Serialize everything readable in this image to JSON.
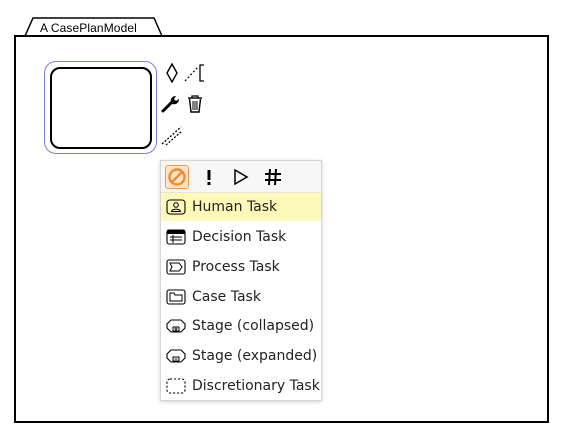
{
  "case_plan_model": {
    "name": "A CasePlanModel"
  },
  "selected_task": {
    "label": ""
  },
  "context_pad": {
    "icons": [
      "diamond-icon",
      "connector-bracket-icon",
      "wrench-icon",
      "trash-icon",
      "dashed-connector-icon"
    ]
  },
  "popup_menu": {
    "header_buttons": [
      {
        "name": "blocking-toggle",
        "symbol": "⊘",
        "active": true
      },
      {
        "name": "required-toggle",
        "symbol": "!",
        "active": false
      },
      {
        "name": "manual-activation-toggle",
        "symbol": "▷",
        "active": false
      },
      {
        "name": "repetition-toggle",
        "symbol": "#",
        "active": false
      }
    ],
    "items": [
      {
        "label": "Human Task",
        "icon": "human-task-icon",
        "highlighted": true
      },
      {
        "label": "Decision Task",
        "icon": "decision-task-icon",
        "highlighted": false
      },
      {
        "label": "Process Task",
        "icon": "process-task-icon",
        "highlighted": false
      },
      {
        "label": "Case Task",
        "icon": "case-task-icon",
        "highlighted": false
      },
      {
        "label": "Stage (collapsed)",
        "icon": "stage-collapsed-icon",
        "highlighted": false
      },
      {
        "label": "Stage (expanded)",
        "icon": "stage-expanded-icon",
        "highlighted": false
      },
      {
        "label": "Discretionary Task",
        "icon": "discretionary-task-icon",
        "highlighted": false
      }
    ]
  },
  "colors": {
    "selection_outline": "#7b7ee6",
    "active_toggle_fill": "#fce3cc",
    "active_toggle_accent": "#f08a2c",
    "highlight_row": "#fdf9b8"
  }
}
